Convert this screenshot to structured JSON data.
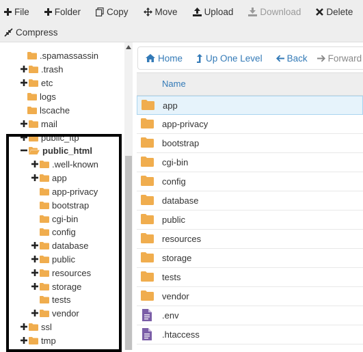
{
  "toolbar": {
    "file": "File",
    "folder": "Folder",
    "copy": "Copy",
    "move": "Move",
    "upload": "Upload",
    "download": "Download",
    "delete": "Delete",
    "compress": "Compress"
  },
  "tree": {
    "items": [
      {
        "label": ".spamassassin",
        "toggle": ""
      },
      {
        "label": ".trash",
        "toggle": "+"
      },
      {
        "label": "etc",
        "toggle": "+"
      },
      {
        "label": "logs",
        "toggle": ""
      },
      {
        "label": "lscache",
        "toggle": ""
      },
      {
        "label": "mail",
        "toggle": "+"
      },
      {
        "label": "public_ftp",
        "toggle": "+"
      },
      {
        "label": "public_html",
        "toggle": "−"
      },
      {
        "label": ".well-known",
        "toggle": "+"
      },
      {
        "label": "app",
        "toggle": "+"
      },
      {
        "label": "app-privacy",
        "toggle": ""
      },
      {
        "label": "bootstrap",
        "toggle": ""
      },
      {
        "label": "cgi-bin",
        "toggle": ""
      },
      {
        "label": "config",
        "toggle": ""
      },
      {
        "label": "database",
        "toggle": "+"
      },
      {
        "label": "public",
        "toggle": "+"
      },
      {
        "label": "resources",
        "toggle": "+"
      },
      {
        "label": "storage",
        "toggle": "+"
      },
      {
        "label": "tests",
        "toggle": ""
      },
      {
        "label": "vendor",
        "toggle": "+"
      },
      {
        "label": "ssl",
        "toggle": "+"
      },
      {
        "label": "tmp",
        "toggle": "+"
      }
    ]
  },
  "nav": {
    "home": "Home",
    "up": "Up One Level",
    "back": "Back",
    "forward": "Forward"
  },
  "table": {
    "name_header": "Name",
    "rows": [
      {
        "name": "app",
        "type": "folder"
      },
      {
        "name": "app-privacy",
        "type": "folder"
      },
      {
        "name": "bootstrap",
        "type": "folder"
      },
      {
        "name": "cgi-bin",
        "type": "folder"
      },
      {
        "name": "config",
        "type": "folder"
      },
      {
        "name": "database",
        "type": "folder"
      },
      {
        "name": "public",
        "type": "folder"
      },
      {
        "name": "resources",
        "type": "folder"
      },
      {
        "name": "storage",
        "type": "folder"
      },
      {
        "name": "tests",
        "type": "folder"
      },
      {
        "name": "vendor",
        "type": "folder"
      },
      {
        "name": ".env",
        "type": "file"
      },
      {
        "name": ".htaccess",
        "type": "file"
      }
    ]
  },
  "colors": {
    "folder": "#f0ad4e",
    "link": "#337ab7",
    "file_icon": "#7b5ea7",
    "selected_row": "#e6f3fb"
  }
}
